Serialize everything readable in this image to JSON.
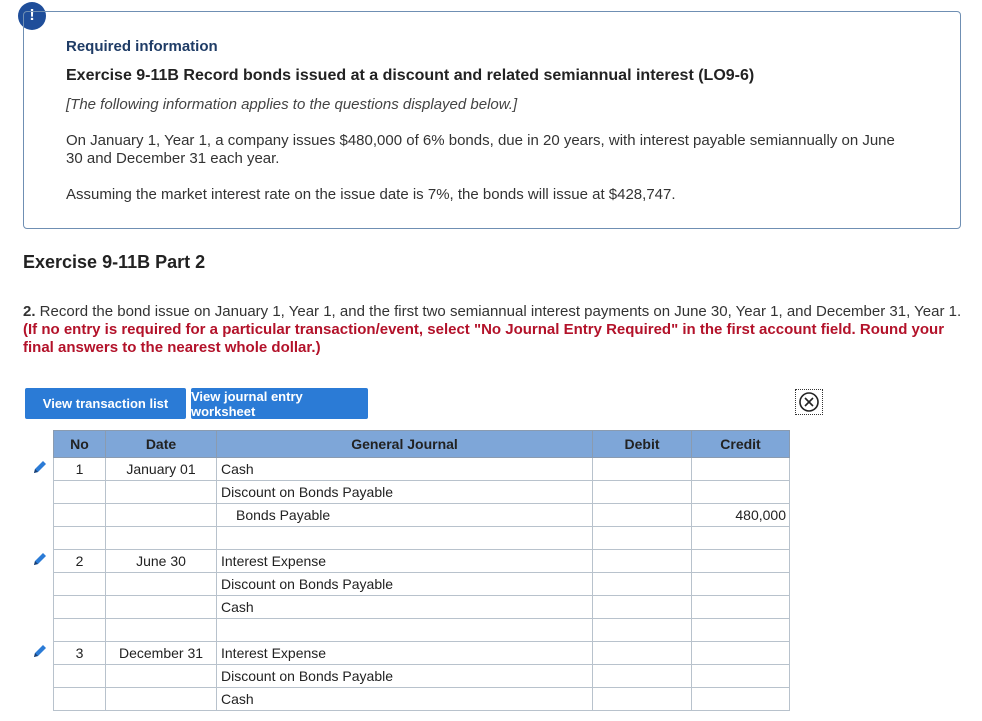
{
  "alert": {
    "symbol": "!"
  },
  "info": {
    "required": "Required information",
    "exercise_title": "Exercise 9-11B Record bonds issued at a discount and related semiannual interest (LO9-6)",
    "note": "[The following information applies to the questions displayed below.]",
    "paragraph1": "On January 1, Year 1, a company issues $480,000 of 6% bonds, due in 20 years, with interest payable semiannually on June 30 and December 31 each year.",
    "paragraph2": "Assuming the market interest rate on the issue date is 7%, the bonds will issue at $428,747."
  },
  "part_title": "Exercise 9-11B Part 2",
  "question": {
    "number": "2.",
    "text": " Record the bond issue on January 1, Year 1, and the first two semiannual interest payments on June 30, Year 1, and December 31, Year 1. ",
    "instruction": "(If no entry is required for a particular transaction/event, select \"No Journal Entry Required\" in the first account field. Round your final answers to the nearest whole dollar.)"
  },
  "buttons": {
    "view_transaction_list": "View transaction list",
    "view_journal_worksheet": "View journal entry worksheet"
  },
  "journal": {
    "headers": {
      "no": "No",
      "date": "Date",
      "account": "General Journal",
      "debit": "Debit",
      "credit": "Credit"
    },
    "rows": [
      {
        "no": "1",
        "date": "January 01",
        "account": "Cash",
        "debit": "",
        "credit": ""
      },
      {
        "no": "",
        "date": "",
        "account": "Discount on Bonds Payable",
        "debit": "",
        "credit": ""
      },
      {
        "no": "",
        "date": "",
        "account": "Bonds Payable",
        "debit": "",
        "credit": "480,000"
      },
      {
        "no": "",
        "date": "",
        "account": "",
        "debit": "",
        "credit": ""
      },
      {
        "no": "2",
        "date": "June 30",
        "account": "Interest Expense",
        "debit": "",
        "credit": ""
      },
      {
        "no": "",
        "date": "",
        "account": "Discount on Bonds Payable",
        "debit": "",
        "credit": ""
      },
      {
        "no": "",
        "date": "",
        "account": "Cash",
        "debit": "",
        "credit": ""
      },
      {
        "no": "",
        "date": "",
        "account": "",
        "debit": "",
        "credit": ""
      },
      {
        "no": "3",
        "date": "December 31",
        "account": "Interest Expense",
        "debit": "",
        "credit": ""
      },
      {
        "no": "",
        "date": "",
        "account": "Discount on Bonds Payable",
        "debit": "",
        "credit": ""
      },
      {
        "no": "",
        "date": "",
        "account": "Cash",
        "debit": "",
        "credit": ""
      }
    ]
  },
  "colors": {
    "accent": "#2b7bd6",
    "header": "#7ea6d8",
    "instruction": "#b3122a",
    "badge": "#1f4e9a"
  },
  "icons": {
    "edit": "pencil-icon",
    "close": "close-circle-icon",
    "alert": "alert-icon"
  }
}
